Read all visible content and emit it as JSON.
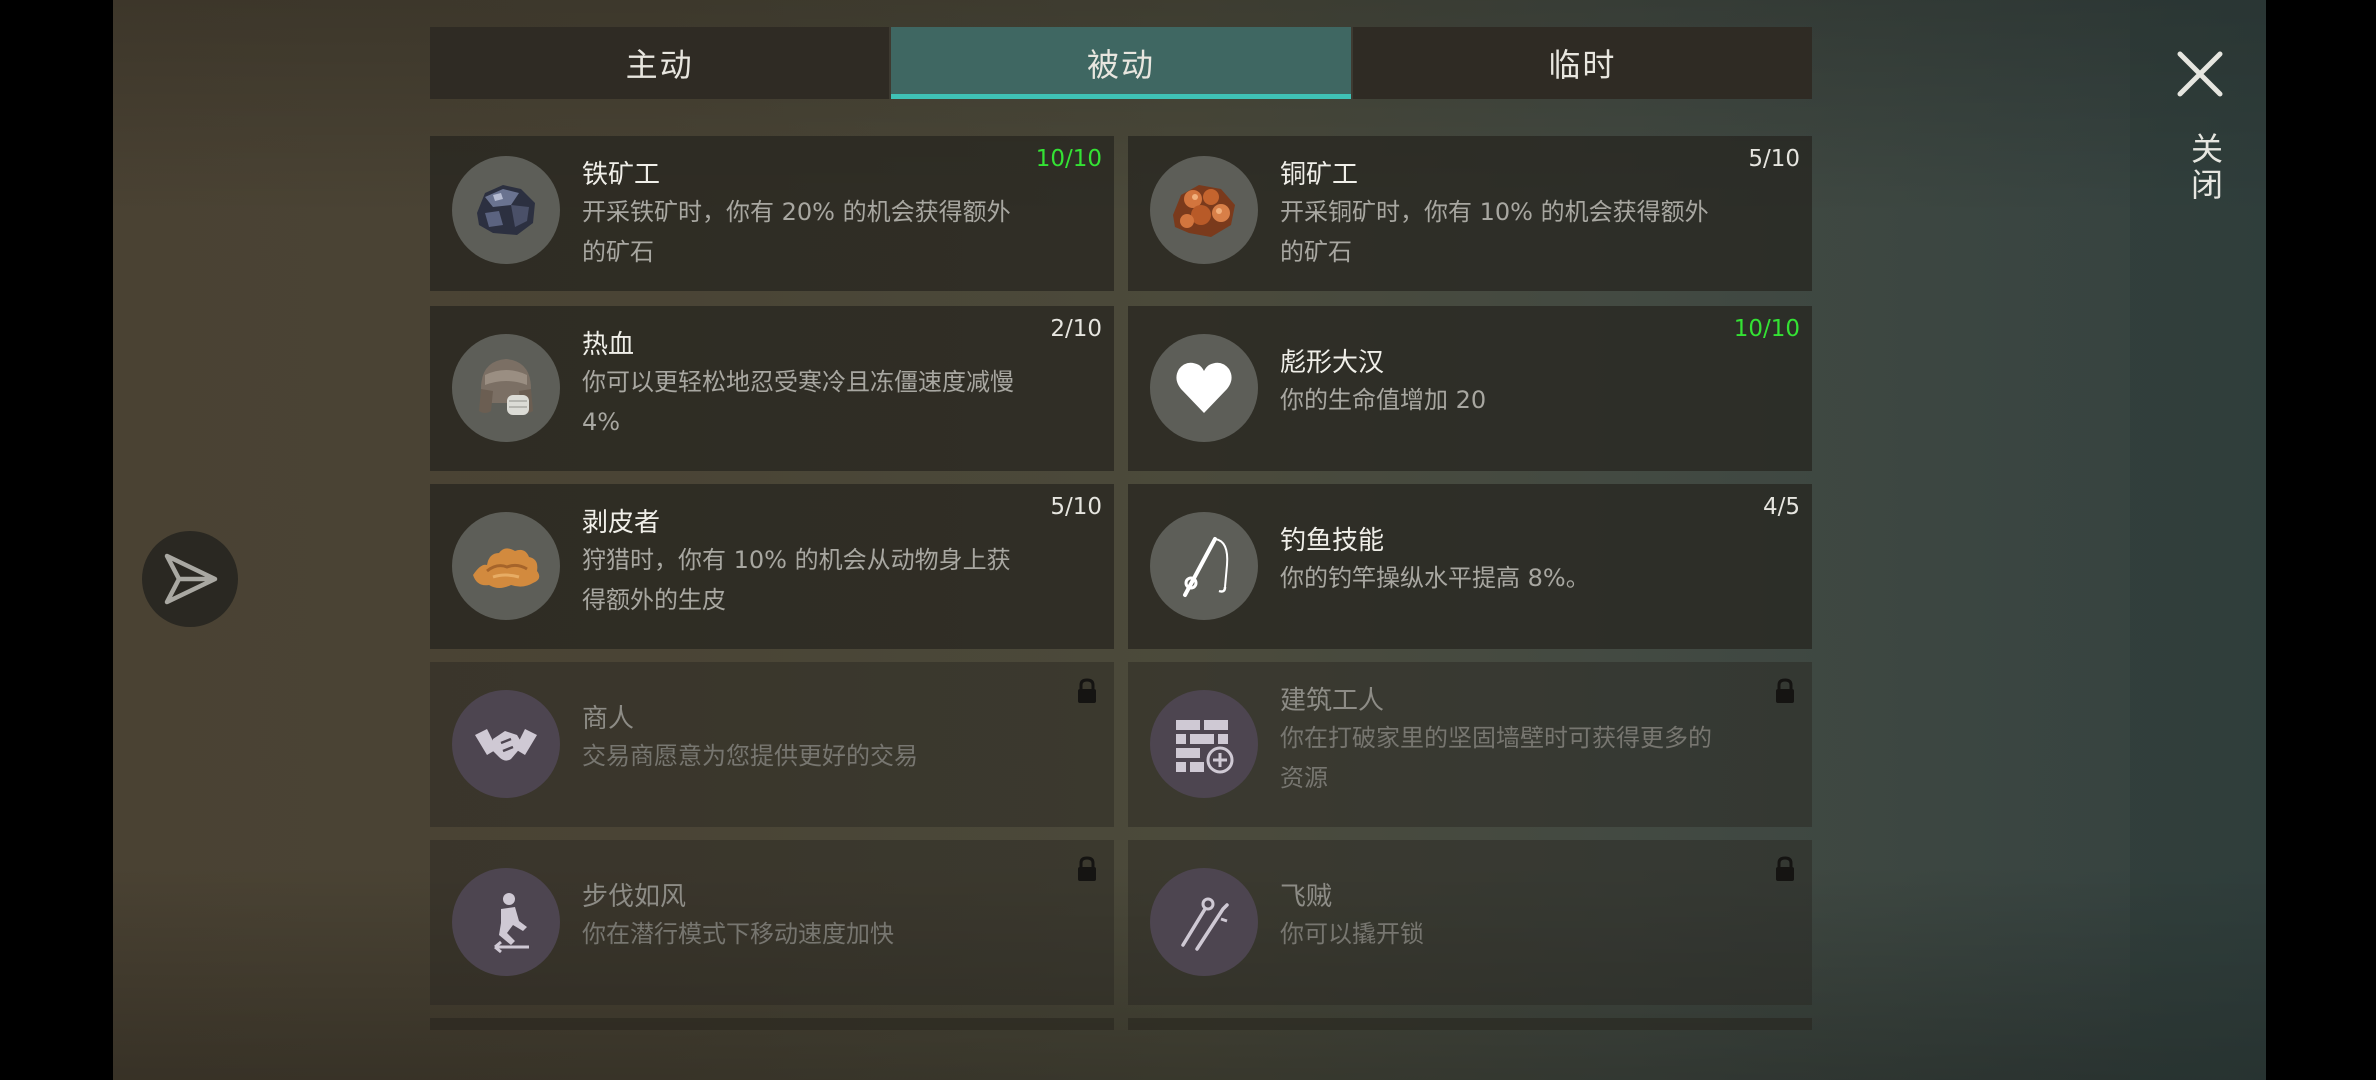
{
  "tabs": [
    {
      "label": "主动"
    },
    {
      "label": "被动"
    },
    {
      "label": "临时"
    }
  ],
  "active_tab": "被动",
  "close": {
    "label": "关闭"
  },
  "skills": [
    {
      "title": "铁矿工",
      "desc": "开采铁矿时，你有 20% 的机会获得额外的矿石",
      "level": "10/10",
      "icon": "iron-ore-icon"
    },
    {
      "title": "铜矿工",
      "desc": "开采铜矿时，你有 10% 的机会获得额外的矿石",
      "level": "5/10",
      "icon": "copper-ore-icon"
    },
    {
      "title": "热血",
      "desc": "你可以更轻松地忍受寒冷且冻僵速度减慢 4%",
      "level": "2/10",
      "icon": "fur-hat-icon"
    },
    {
      "title": "彪形大汉",
      "desc": "你的生命值增加 20",
      "level": "10/10",
      "icon": "heart-icon"
    },
    {
      "title": "剥皮者",
      "desc": "狩猎时，你有 10% 的机会从动物身上获得额外的生皮",
      "level": "5/10",
      "icon": "hide-icon"
    },
    {
      "title": "钓鱼技能",
      "desc": "你的钓竿操纵水平提高 8%。",
      "level": "4/5",
      "icon": "fishing-rod-icon"
    },
    {
      "title": "商人",
      "desc": "交易商愿意为您提供更好的交易",
      "locked": true,
      "icon": "handshake-icon"
    },
    {
      "title": "建筑工人",
      "desc": "你在打破家里的坚固墙壁时可获得更多的资源",
      "locked": true,
      "icon": "brick-wall-icon"
    },
    {
      "title": "步伐如风",
      "desc": "你在潜行模式下移动速度加快",
      "locked": true,
      "icon": "sneaking-icon"
    },
    {
      "title": "飞贼",
      "desc": "你可以撬开锁",
      "locked": true,
      "icon": "lockpick-icon"
    }
  ],
  "colors": {
    "active_tab": "#3f6762",
    "tab_underline": "#3fc2b6",
    "max_level": "#34e234"
  }
}
